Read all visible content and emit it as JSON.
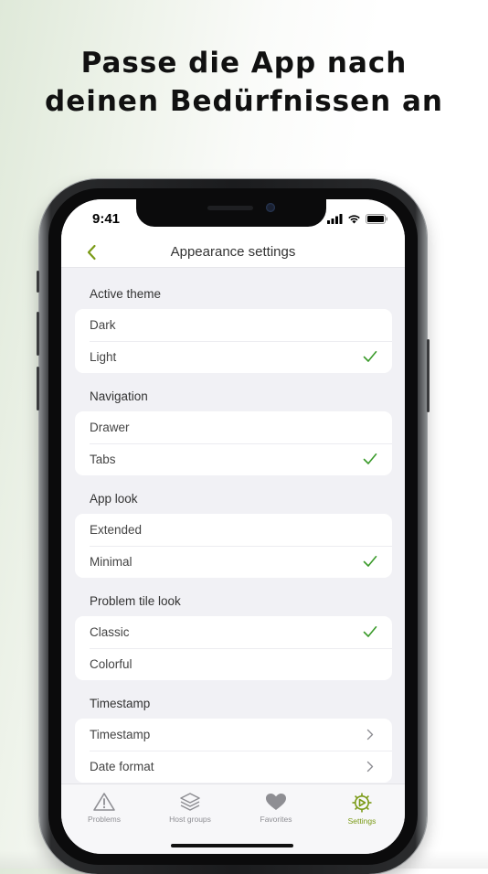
{
  "headline": {
    "line1": "Passe die App nach",
    "line2": "deinen Bedürfnissen an"
  },
  "status_bar": {
    "time": "9:41"
  },
  "nav": {
    "title": "Appearance settings",
    "back_icon": "chevron-left-icon"
  },
  "colors": {
    "accent": "#7a9a16",
    "check": "#3a9a2a"
  },
  "sections": [
    {
      "title": "Active theme",
      "rows": [
        {
          "label": "Dark",
          "checked": false
        },
        {
          "label": "Light",
          "checked": true
        }
      ]
    },
    {
      "title": "Navigation",
      "rows": [
        {
          "label": "Drawer",
          "checked": false
        },
        {
          "label": "Tabs",
          "checked": true
        }
      ]
    },
    {
      "title": "App look",
      "rows": [
        {
          "label": "Extended",
          "checked": false
        },
        {
          "label": "Minimal",
          "checked": true
        }
      ]
    },
    {
      "title": "Problem tile look",
      "rows": [
        {
          "label": "Classic",
          "checked": true
        },
        {
          "label": "Colorful",
          "checked": false
        }
      ]
    },
    {
      "title": "Timestamp",
      "rows": [
        {
          "label": "Timestamp",
          "disclosure": true
        },
        {
          "label": "Date format",
          "disclosure": true
        }
      ]
    }
  ],
  "tabs": [
    {
      "label": "Problems",
      "icon": "warning-triangle-icon",
      "active": false
    },
    {
      "label": "Host groups",
      "icon": "layers-icon",
      "active": false
    },
    {
      "label": "Favorites",
      "icon": "heart-icon",
      "active": false
    },
    {
      "label": "Settings",
      "icon": "gear-icon",
      "active": true
    }
  ]
}
